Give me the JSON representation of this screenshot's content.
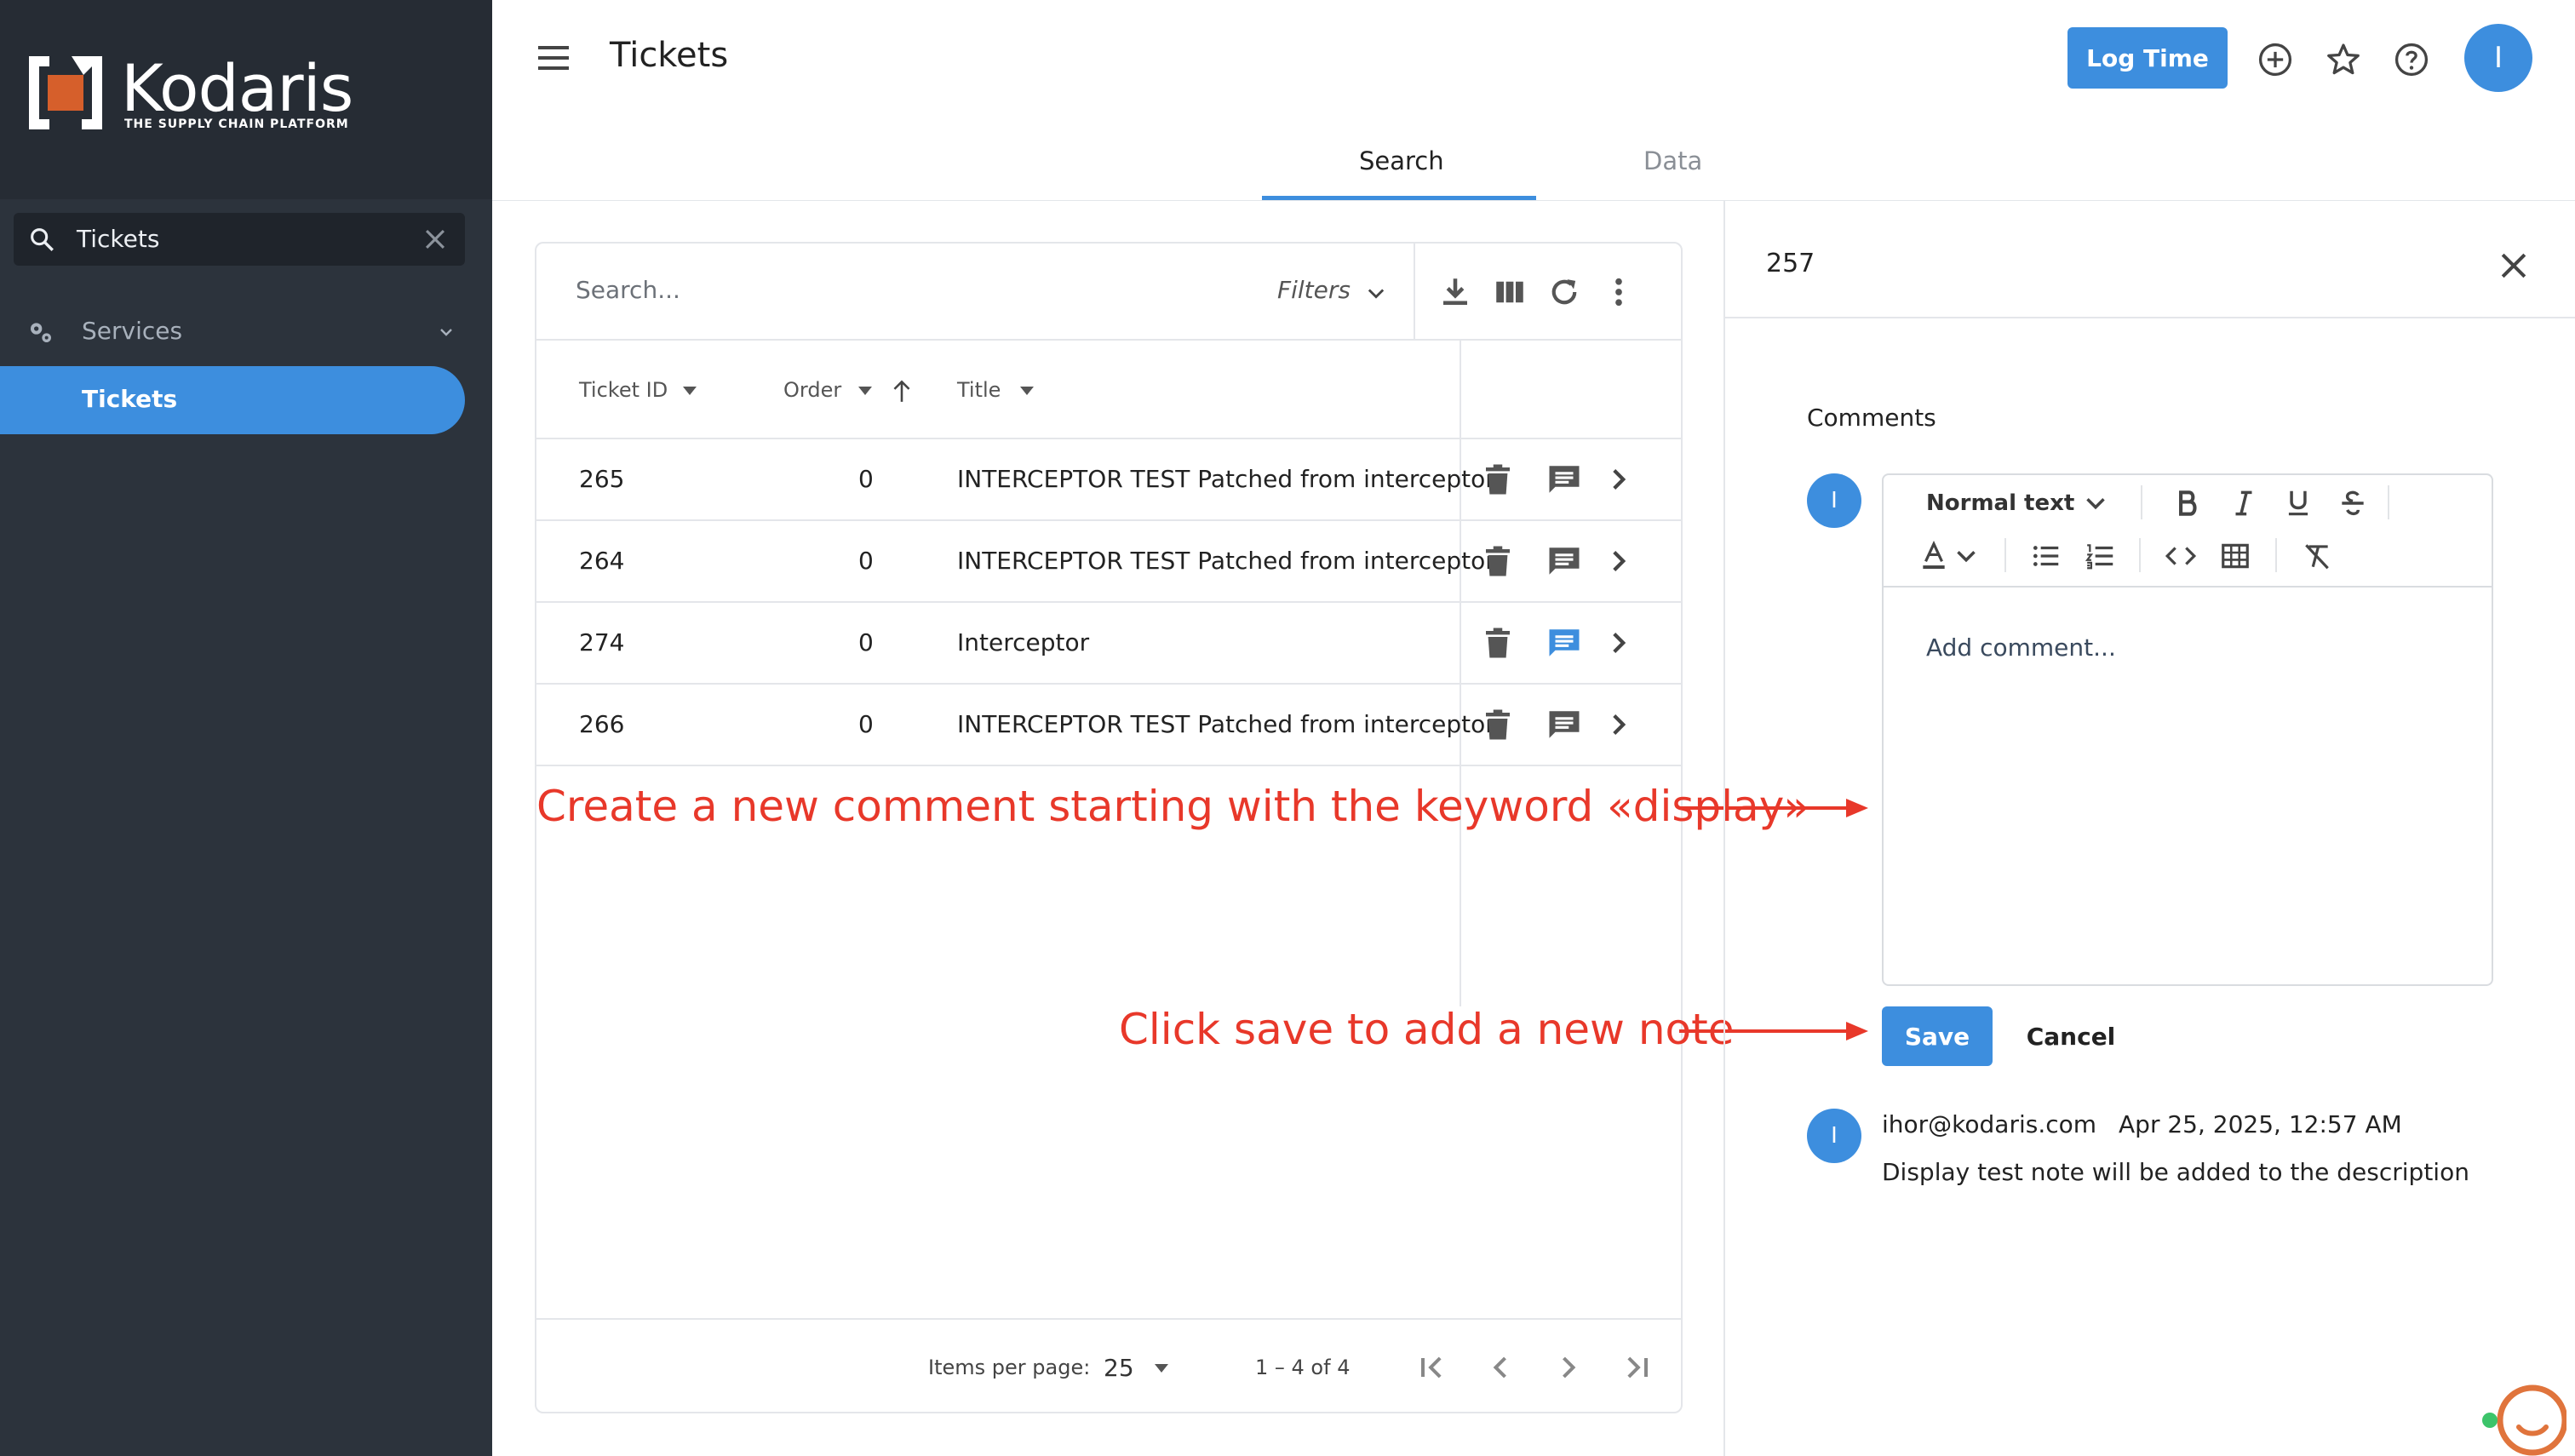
{
  "brand": {
    "name": "Kodaris",
    "tagline": "THE SUPPLY CHAIN PLATFORM",
    "accent": "#3d8ede",
    "sidebar_bg": "#2c333c",
    "annotation_color": "#e8382a"
  },
  "sidebar": {
    "search_value": "Tickets",
    "items": [
      {
        "label": "Services",
        "icon": "gears-icon"
      },
      {
        "label": "Tickets",
        "active": true
      }
    ]
  },
  "header": {
    "title": "Tickets",
    "log_time": "Log Time",
    "user_initial": "I"
  },
  "tabs": [
    {
      "label": "Search",
      "active": true
    },
    {
      "label": "Data",
      "active": false
    }
  ],
  "table": {
    "search_placeholder": "Search...",
    "filters_label": "Filters",
    "columns": [
      "Ticket ID",
      "Order",
      "Title"
    ],
    "rows": [
      {
        "id": "265",
        "order": "0",
        "title": "INTERCEPTOR TEST Patched from interceptor"
      },
      {
        "id": "264",
        "order": "0",
        "title": "INTERCEPTOR TEST Patched from interceptor"
      },
      {
        "id": "274",
        "order": "0",
        "title": "Interceptor"
      },
      {
        "id": "266",
        "order": "0",
        "title": "INTERCEPTOR TEST Patched from interceptor"
      }
    ],
    "items_per_page_label": "Items per page:",
    "items_per_page": "25",
    "range": "1 – 4 of 4"
  },
  "annotations": {
    "comment": "Create a new comment starting with the keyword «display»",
    "save": "Click save to add a new note"
  },
  "panel": {
    "ticket_id": "257",
    "comments_label": "Comments",
    "editor_format": "Normal text",
    "editor_placeholder": "Add comment...",
    "save": "Save",
    "cancel": "Cancel",
    "avatar_initial": "I",
    "note": {
      "author": "ihor@kodaris.com",
      "date": "Apr 25, 2025, 12:57 AM",
      "text": "Display test note will be added to the description"
    }
  }
}
